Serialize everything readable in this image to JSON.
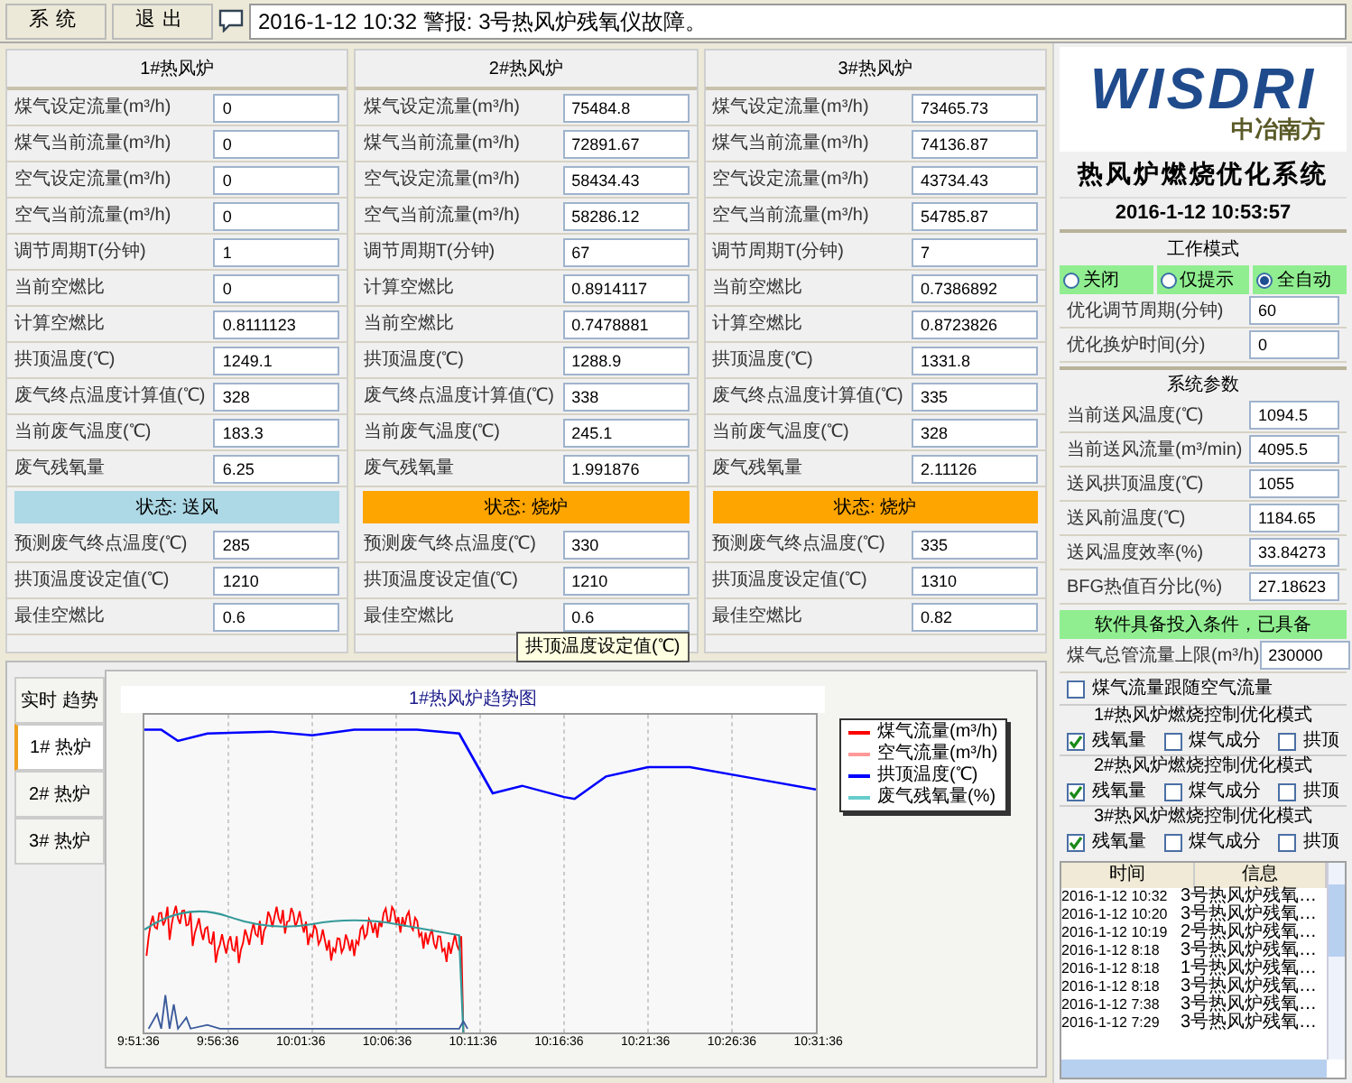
{
  "top_bar": {
    "menu": [
      {
        "label": "系统"
      },
      {
        "label": "退出"
      }
    ],
    "alarm": "2016-1-12 10:32 警报: 3号热风炉残氧仪故障。"
  },
  "stoves": [
    {
      "title": "1#热风炉",
      "fields": [
        {
          "label": "煤气设定流量(m³/h)",
          "value": "0"
        },
        {
          "label": "煤气当前流量(m³/h)",
          "value": "0"
        },
        {
          "label": "空气设定流量(m³/h)",
          "value": "0"
        },
        {
          "label": "空气当前流量(m³/h)",
          "value": "0"
        },
        {
          "label": "调节周期T(分钟)",
          "value": "1"
        },
        {
          "label": "当前空燃比",
          "value": "0"
        },
        {
          "label": "计算空燃比",
          "value": "0.8111123"
        },
        {
          "label": "拱顶温度(℃)",
          "value": "1249.1"
        },
        {
          "label": "废气终点温度计算值(℃)",
          "value": "328"
        },
        {
          "label": "当前废气温度(℃)",
          "value": "183.3"
        },
        {
          "label": "废气残氧量",
          "value": "6.25"
        }
      ],
      "status": {
        "label": "状态: 送风",
        "kind": "blast"
      },
      "lower_fields": [
        {
          "label": "预测废气终点温度(℃)",
          "value": "285"
        },
        {
          "label": "拱顶温度设定值(℃)",
          "value": "1210"
        },
        {
          "label": "最佳空燃比",
          "value": "0.6"
        }
      ]
    },
    {
      "title": "2#热风炉",
      "fields": [
        {
          "label": "煤气设定流量(m³/h)",
          "value": "75484.8"
        },
        {
          "label": "煤气当前流量(m³/h)",
          "value": "72891.67"
        },
        {
          "label": "空气设定流量(m³/h)",
          "value": "58434.43"
        },
        {
          "label": "空气当前流量(m³/h)",
          "value": "58286.12"
        },
        {
          "label": "调节周期T(分钟)",
          "value": "67"
        },
        {
          "label": "计算空燃比",
          "value": "0.8914117"
        },
        {
          "label": "当前空燃比",
          "value": "0.7478881"
        },
        {
          "label": "拱顶温度(℃)",
          "value": "1288.9"
        },
        {
          "label": "废气终点温度计算值(℃)",
          "value": "338"
        },
        {
          "label": "当前废气温度(℃)",
          "value": "245.1"
        },
        {
          "label": "废气残氧量",
          "value": "1.991876"
        }
      ],
      "status": {
        "label": "状态: 烧炉",
        "kind": "burn"
      },
      "lower_fields": [
        {
          "label": "预测废气终点温度(℃)",
          "value": "330"
        },
        {
          "label": "拱顶温度设定值(℃)",
          "value": "1210"
        },
        {
          "label": "最佳空燃比",
          "value": "0.6"
        }
      ],
      "tooltip": "拱顶温度设定值(℃)"
    },
    {
      "title": "3#热风炉",
      "fields": [
        {
          "label": "煤气设定流量(m³/h)",
          "value": "73465.73"
        },
        {
          "label": "煤气当前流量(m³/h)",
          "value": "74136.87"
        },
        {
          "label": "空气设定流量(m³/h)",
          "value": "43734.43"
        },
        {
          "label": "空气当前流量(m³/h)",
          "value": "54785.87"
        },
        {
          "label": "调节周期T(分钟)",
          "value": "7"
        },
        {
          "label": "当前空燃比",
          "value": "0.7386892"
        },
        {
          "label": "计算空燃比",
          "value": "0.8723826"
        },
        {
          "label": "拱顶温度(℃)",
          "value": "1331.8"
        },
        {
          "label": "废气终点温度计算值(℃)",
          "value": "335"
        },
        {
          "label": "当前废气温度(℃)",
          "value": "328"
        },
        {
          "label": "废气残氧量",
          "value": "2.11126"
        }
      ],
      "status": {
        "label": "状态: 烧炉",
        "kind": "burn"
      },
      "lower_fields": [
        {
          "label": "预测废气终点温度(℃)",
          "value": "335"
        },
        {
          "label": "拱顶温度设定值(℃)",
          "value": "1310"
        },
        {
          "label": "最佳空燃比",
          "value": "0.82"
        }
      ]
    }
  ],
  "sidebar": {
    "logo": {
      "text": "WISDRI",
      "subtitle": "中冶南方"
    },
    "title": "热风炉燃烧优化系统",
    "datetime": "2016-1-12 10:53:57",
    "work_mode": {
      "title": "工作模式",
      "options": [
        {
          "label": "关闭",
          "selected": false
        },
        {
          "label": "仅提示",
          "selected": false
        },
        {
          "label": "全自动",
          "selected": true
        }
      ],
      "fields": [
        {
          "label": "优化调节周期(分钟)",
          "value": "60"
        },
        {
          "label": "优化换炉时间(分)",
          "value": "0"
        }
      ]
    },
    "system_params": {
      "title": "系统参数",
      "fields": [
        {
          "label": "当前送风温度(℃)",
          "value": "1094.5"
        },
        {
          "label": "当前送风流量(m³/min)",
          "value": "4095.5"
        },
        {
          "label": "送风拱顶温度(℃)",
          "value": "1055"
        },
        {
          "label": "送风前温度(℃)",
          "value": "1184.65"
        },
        {
          "label": "送风温度效率(%)",
          "value": "33.84273"
        },
        {
          "label": "BFG热值百分比(%)",
          "value": "27.18623"
        }
      ]
    },
    "condition": "软件具备投入条件，已具备",
    "gas_limit": {
      "label": "煤气总管流量上限(m³/h)",
      "value": "230000"
    },
    "follow": {
      "label": "煤气流量跟随空气流量",
      "checked": false
    },
    "modes": [
      {
        "title": "1#热风炉燃烧控制优化模式",
        "options": [
          {
            "label": "残氧量",
            "checked": true
          },
          {
            "label": "煤气成分",
            "checked": false
          },
          {
            "label": "拱顶",
            "checked": false
          }
        ]
      },
      {
        "title": "2#热风炉燃烧控制优化模式",
        "options": [
          {
            "label": "残氧量",
            "checked": true
          },
          {
            "label": "煤气成分",
            "checked": false
          },
          {
            "label": "拱顶",
            "checked": false
          }
        ]
      },
      {
        "title": "3#热风炉燃烧控制优化模式",
        "options": [
          {
            "label": "残氧量",
            "checked": true
          },
          {
            "label": "煤气成分",
            "checked": false
          },
          {
            "label": "拱顶",
            "checked": false
          }
        ]
      }
    ],
    "log": {
      "columns": [
        "时间",
        "信息"
      ],
      "rows": [
        [
          "2016-1-12 10:32",
          "3号热风炉残氧…"
        ],
        [
          "2016-1-12 10:20",
          "3号热风炉残氧…"
        ],
        [
          "2016-1-12 10:19",
          "2号热风炉残氧…"
        ],
        [
          "2016-1-12 8:18",
          "3号热风炉残氧…"
        ],
        [
          "2016-1-12 8:18",
          "1号热风炉残氧…"
        ],
        [
          "2016-1-12 8:18",
          "3号热风炉残氧…"
        ],
        [
          "2016-1-12 7:38",
          "3号热风炉残氧…"
        ],
        [
          "2016-1-12 7:29",
          "3号热风炉残氧…"
        ]
      ]
    }
  },
  "trend_tabs": [
    {
      "label": "实时 趋势",
      "selected": false
    },
    {
      "label": "1# 热炉",
      "selected": true
    },
    {
      "label": "2# 热炉",
      "selected": false
    },
    {
      "label": "3# 热炉",
      "selected": false
    }
  ],
  "chart": {
    "title": "1#热风炉趋势图",
    "legend": [
      {
        "label": "煤气流量(m³/h)",
        "color": "#ff0000"
      },
      {
        "label": "空气流量(m³/h)",
        "color": "#ff9999"
      },
      {
        "label": "拱顶温度(℃)",
        "color": "#0000ff"
      },
      {
        "label": "废气残氧量(%)",
        "color": "#66cccc"
      }
    ],
    "x_labels": [
      "9:51:36",
      "9:56:36",
      "10:01:36",
      "10:06:36",
      "10:11:36",
      "10:16:36",
      "10:21:36",
      "10:26:36",
      "10:31:36"
    ]
  }
}
